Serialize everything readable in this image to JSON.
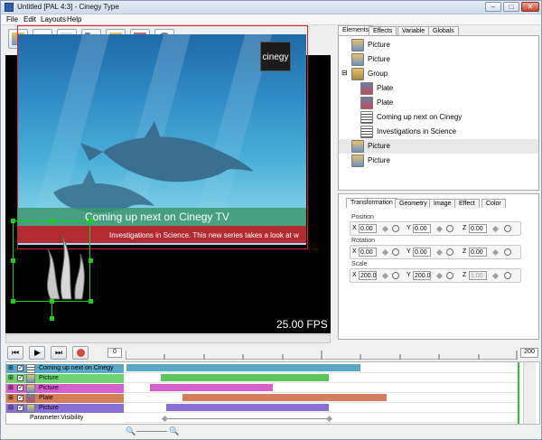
{
  "window": {
    "title": "Untitled [PAL 4:3] - Cinegy Type",
    "minimize": "–",
    "maximize": "□",
    "close": "✕"
  },
  "menu": [
    "File",
    "Edit",
    "Layouts",
    "Help"
  ],
  "toolbar": {
    "tools": [
      "picture-tool",
      "text-tool",
      "crawl-tool",
      "roll-tool",
      "flag-tool",
      "plate-tool",
      "clock-tool"
    ]
  },
  "preview": {
    "logo_text": "cinegy",
    "lower_third_headline": "Coming up next on Cinegy TV",
    "lower_third_crawl": "Investigations in Science. This new series takes a look at w",
    "fps": "25.00 FPS"
  },
  "right_panel": {
    "tabs": [
      "Elements",
      "Effects",
      "Variable",
      "Globals"
    ],
    "tree": [
      {
        "label": "Picture",
        "depth": 1,
        "type": "picture"
      },
      {
        "label": "Picture",
        "depth": 1,
        "type": "picture"
      },
      {
        "label": "Group",
        "depth": 0,
        "type": "group"
      },
      {
        "label": "Plate",
        "depth": 1,
        "type": "plate"
      },
      {
        "label": "Plate",
        "depth": 1,
        "type": "plate"
      },
      {
        "label": "Coming up next on Cinegy",
        "depth": 1,
        "type": "text"
      },
      {
        "label": "Investigations in Science",
        "depth": 1,
        "type": "text"
      },
      {
        "label": "Picture",
        "depth": 1,
        "type": "picture",
        "selected": true
      },
      {
        "label": "Picture",
        "depth": 1,
        "type": "picture"
      }
    ],
    "prop_tabs": [
      "Transformation",
      "Geometry",
      "Image",
      "Effect",
      "Color"
    ],
    "position": {
      "label": "Position",
      "x": "0.00",
      "y": "0.00",
      "z": "0.00"
    },
    "rotation": {
      "label": "Rotation",
      "x": "0.00",
      "y": "0.00",
      "z": "0.00"
    },
    "scale": {
      "label": "Scale",
      "x": "200.0",
      "y": "200.0",
      "z": "1.00"
    }
  },
  "timeline": {
    "start": "0",
    "end": "200",
    "tracks": [
      {
        "label": "Coming up next on Cinegy",
        "color": "#5aa8c8",
        "bar_color": "#5aa8c8"
      },
      {
        "label": "Picture",
        "color": "#6fd36f",
        "bar_color": "#5ec45e"
      },
      {
        "label": "Picture",
        "color": "#d65fcf",
        "bar_color": "#d65fcf"
      },
      {
        "label": "Plate",
        "color": "#d67e5c",
        "bar_color": "#d67e5c"
      },
      {
        "label": "Picture",
        "color": "#8a6fd6",
        "bar_color": "#8a6fd6"
      }
    ],
    "param_label": "Parameter.Visibility"
  }
}
